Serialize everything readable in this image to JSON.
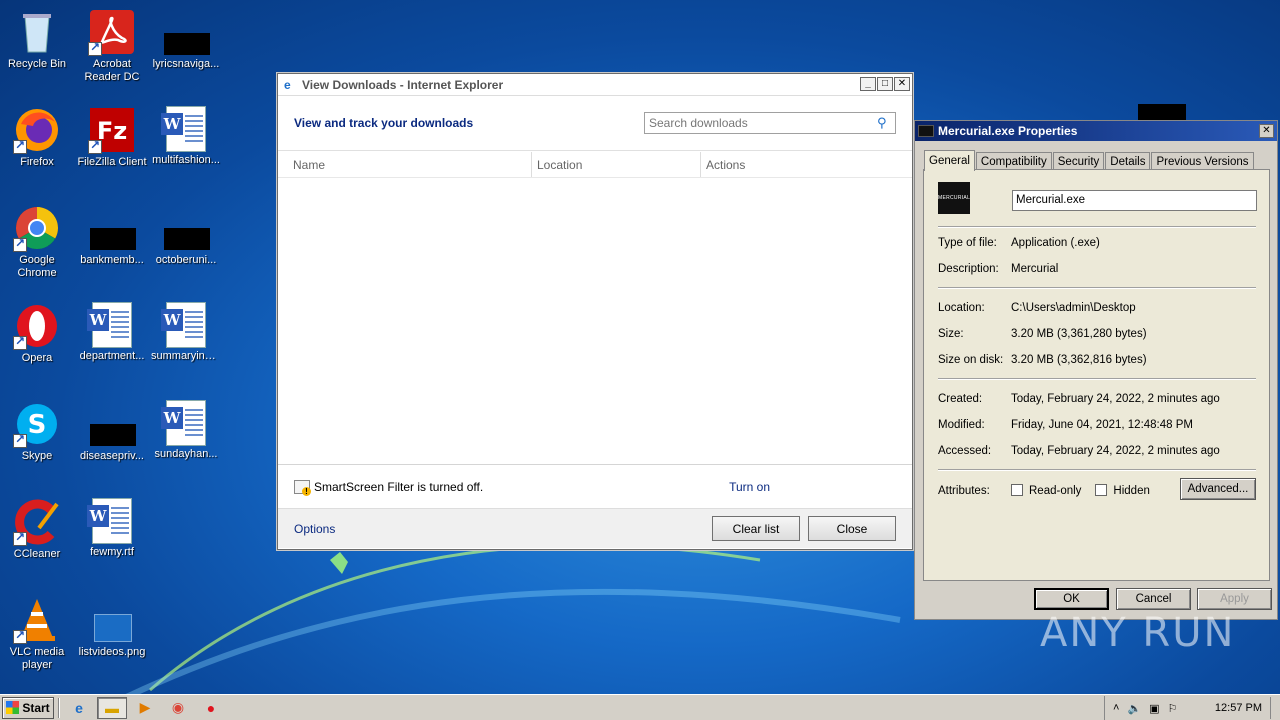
{
  "desktop": {
    "icons": {
      "recycle_bin": "Recycle Bin",
      "acrobat": "Acrobat Reader DC",
      "lyrics": "lyricsnaviga...",
      "firefox": "Firefox",
      "filezilla": "FileZilla Client",
      "multifashion": "multifashion...",
      "chrome": "Google Chrome",
      "bankmemb": "bankmemb...",
      "octoberuni": "octoberuni...",
      "opera": "Opera",
      "department": "department...",
      "summaryincl": "summaryincl...",
      "skype": "Skype",
      "diseasepriv": "diseasepriv...",
      "sundayhan": "sundayhan...",
      "ccleaner": "CCleaner",
      "fewmy": "fewmy.rtf",
      "vlc": "VLC media player",
      "listvideos": "listvideos.png"
    },
    "watermark": "ANY RUN"
  },
  "ie_window": {
    "title": "View Downloads - Internet Explorer",
    "heading": "View and track your downloads",
    "search_placeholder": "Search downloads",
    "columns": [
      "Name",
      "Location",
      "Actions"
    ],
    "smartscreen_text": "SmartScreen Filter is turned off.",
    "turn_on": "Turn on",
    "options": "Options",
    "clear_list": "Clear list",
    "close": "Close"
  },
  "properties": {
    "title": "Mercurial.exe Properties",
    "tabs": [
      "General",
      "Compatibility",
      "Security",
      "Details",
      "Previous Versions"
    ],
    "file_logo_text": "MERCURIAL",
    "file_name": "Mercurial.exe",
    "type_label": "Type of file:",
    "type_value": "Application (.exe)",
    "desc_label": "Description:",
    "desc_value": "Mercurial",
    "location_label": "Location:",
    "location_value": "C:\\Users\\admin\\Desktop",
    "size_label": "Size:",
    "size_value": "3.20 MB (3,361,280 bytes)",
    "size_disk_label": "Size on disk:",
    "size_disk_value": "3.20 MB (3,362,816 bytes)",
    "created_label": "Created:",
    "created_value": "Today, February 24, 2022, 2 minutes ago",
    "modified_label": "Modified:",
    "modified_value": "Friday, June 04, 2021, 12:48:48 PM",
    "accessed_label": "Accessed:",
    "accessed_value": "Today, February 24, 2022, 2 minutes ago",
    "attributes_label": "Attributes:",
    "readonly": "Read-only",
    "hidden": "Hidden",
    "advanced": "Advanced...",
    "ok": "OK",
    "cancel": "Cancel",
    "apply": "Apply"
  },
  "taskbar": {
    "start": "Start",
    "clock": "12:57 PM"
  }
}
